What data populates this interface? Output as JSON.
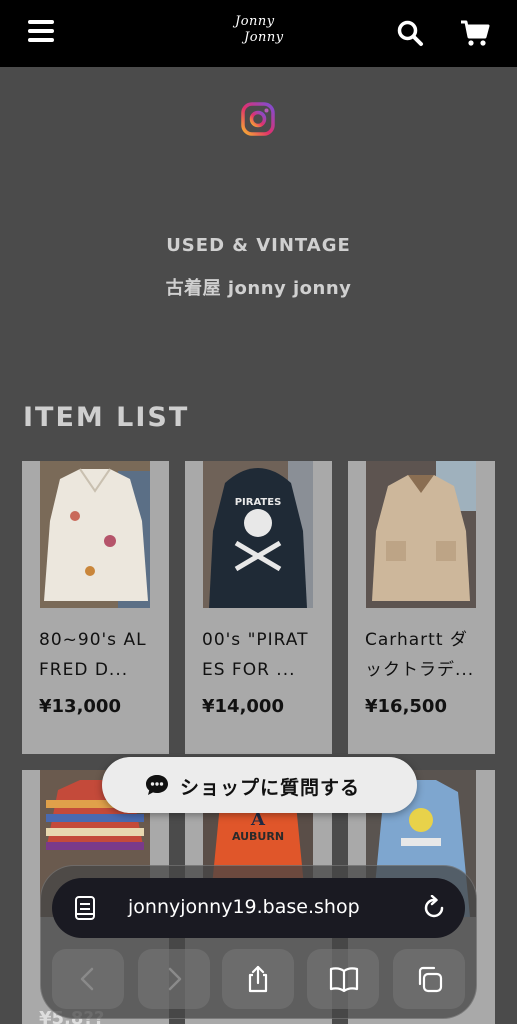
{
  "header": {
    "logo_line1": "Jonny",
    "logo_line2": "Jonny"
  },
  "hero": {
    "tagline": "USED & VINTAGE",
    "shop_name": "古着屋 jonny jonny"
  },
  "section_title": "ITEM LIST",
  "items": [
    {
      "name": "80~90's ALFRED D...",
      "price": "¥13,000"
    },
    {
      "name": "00's \"PIRATES FOR ...",
      "price": "¥14,000"
    },
    {
      "name": "Carhartt ダックトラデ...",
      "price": "¥16,500"
    }
  ],
  "second_row_prices": [
    "¥5,8??",
    "¥?,???",
    "¥?,???"
  ],
  "ask_button": {
    "label": "ショップに質問する"
  },
  "browser": {
    "url": "jonnyjonny19.base.shop"
  },
  "icons": {
    "menu": "hamburger-menu-icon",
    "search": "search-icon",
    "cart": "cart-icon",
    "instagram": "instagram-icon",
    "chat": "chat-bubble-icon",
    "page": "page-menu-icon",
    "reload": "reload-icon",
    "back": "back-arrow-icon",
    "forward": "forward-arrow-icon",
    "share": "share-icon",
    "bookmarks": "book-icon",
    "tabs": "tabs-icon"
  },
  "colors": {
    "background": "#4b4b4b",
    "header": "#000000",
    "card": "#a9a9a9"
  }
}
